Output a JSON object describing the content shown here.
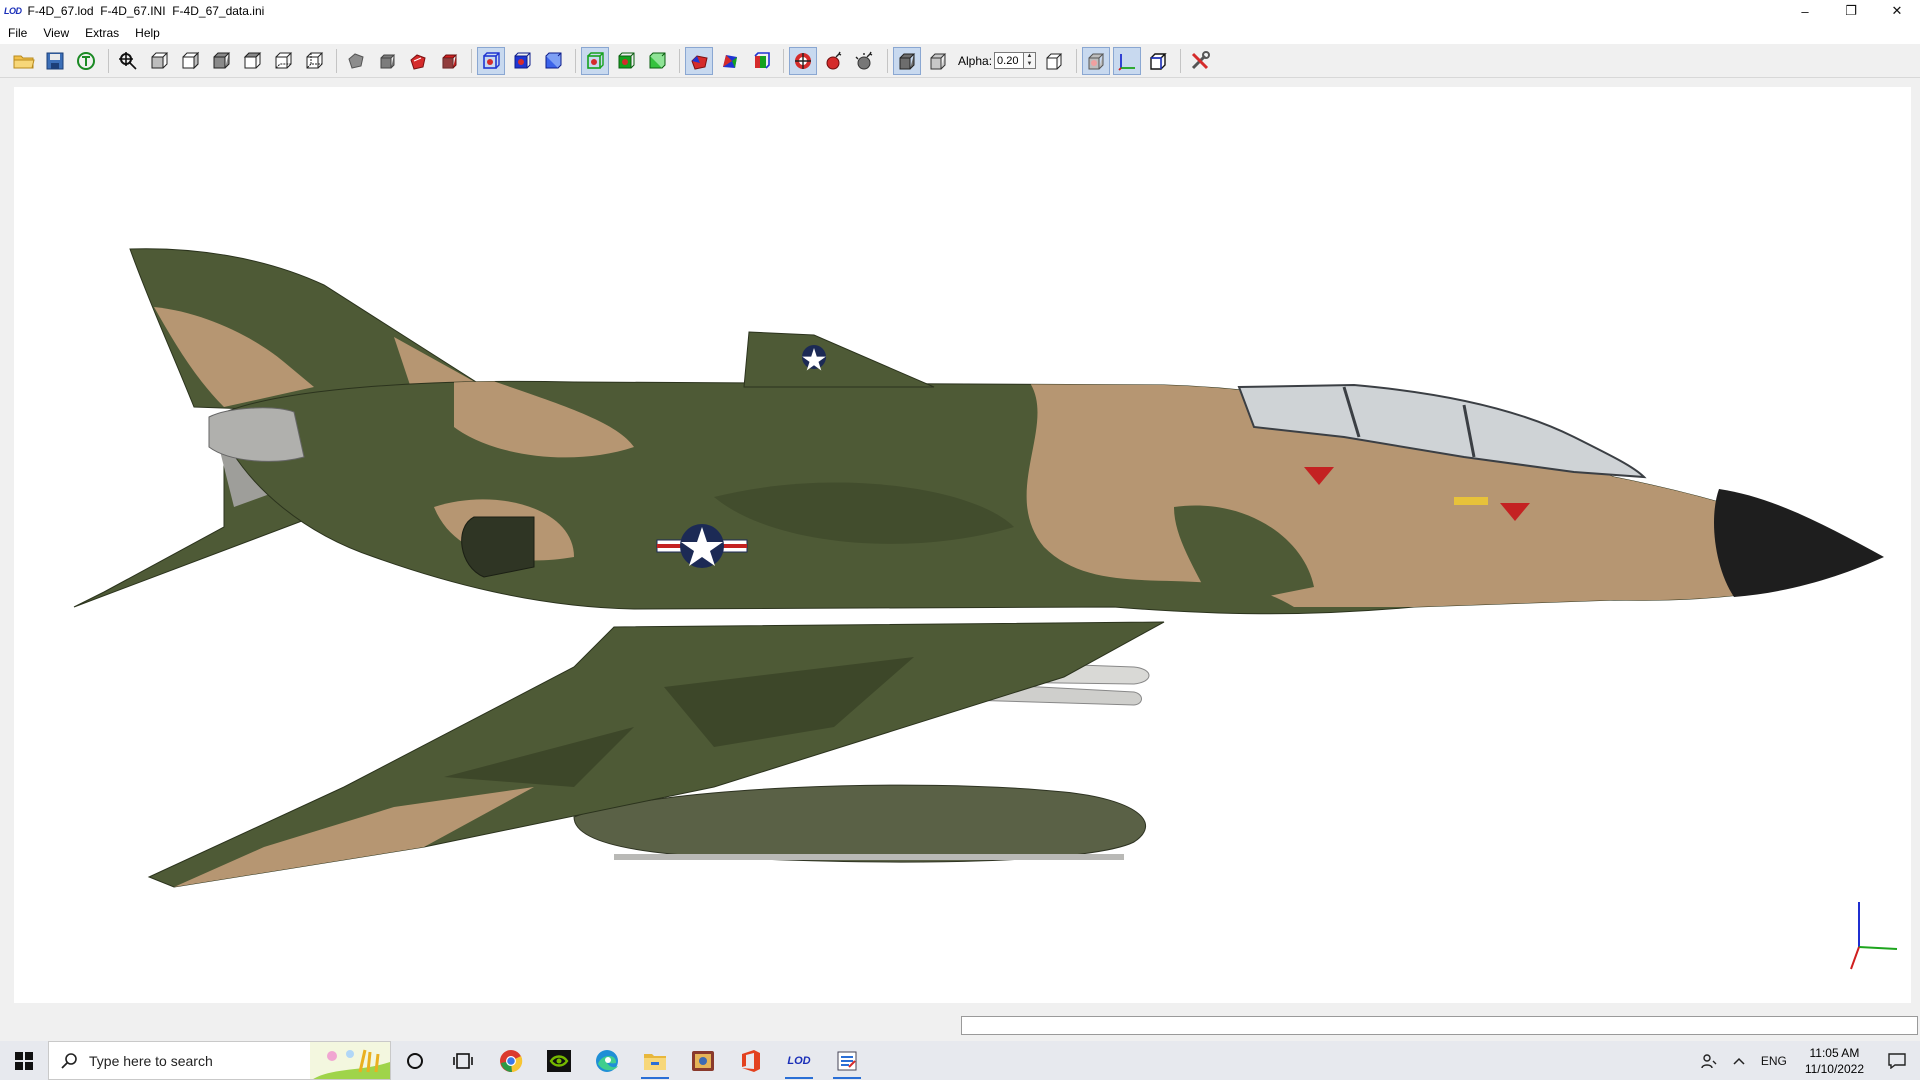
{
  "window": {
    "app_logo": "LOD",
    "title": "F-4D_67.lod  F-4D_67.INI  F-4D_67_data.ini",
    "controls": {
      "minimize": "–",
      "restore": "❐",
      "close": "✕"
    }
  },
  "menu": [
    "File",
    "View",
    "Extras",
    "Help"
  ],
  "toolbar": {
    "icons": [
      "open-folder-icon",
      "save-icon",
      "reload-icon",
      "zoom-fit-icon",
      "view-front-icon",
      "view-back-icon",
      "view-left-icon",
      "view-right-icon",
      "view-top-icon",
      "view-bottom-icon",
      "solid-gray-icon",
      "solid-box-icon",
      "render-red-icon",
      "render-red-box-icon",
      "wire-blue-icon",
      "wire-blue-filled-icon",
      "wire-blue-box-icon",
      "wire-green-icon",
      "wire-green-filled-icon",
      "wire-green-box-icon",
      "color-mesh-icon",
      "multi-color-icon",
      "layers-icon",
      "target-icon",
      "bomb-red-icon",
      "bomb-gray-icon",
      "cube-dark-icon",
      "cube-transparent-icon"
    ],
    "alpha_label": "Alpha:",
    "alpha_value": "0.20",
    "after_alpha_icons": [
      "cube-outline-icon",
      "texture-icon",
      "axes-icon",
      "box-3d-icon",
      "tools-icon"
    ],
    "active": [
      "wire-blue-icon",
      "wire-green-icon",
      "color-mesh-icon",
      "target-icon",
      "cube-dark-icon",
      "texture-icon",
      "axes-icon"
    ]
  },
  "colors": {
    "camo_green": "#4e5a36",
    "camo_tan": "#b69672",
    "camo_dark": "#3d4729",
    "nose": "#1e1e1e",
    "axis_x": "#1ea51e",
    "axis_y": "#1f2fd0",
    "axis_z": "#d01f1f"
  },
  "taskbar": {
    "search_placeholder": "Type here to search",
    "apps": [
      "cortana-circle-icon",
      "task-view-icon",
      "chrome-icon",
      "nvidia-icon",
      "edge-icon",
      "file-explorer-icon",
      "photo-app-icon",
      "office-icon",
      "lod-viewer-icon",
      "editor-app-icon"
    ],
    "lod_label": "LOD",
    "tray_lang": "ENG",
    "time": "11:05 AM",
    "date": "11/10/2022"
  }
}
